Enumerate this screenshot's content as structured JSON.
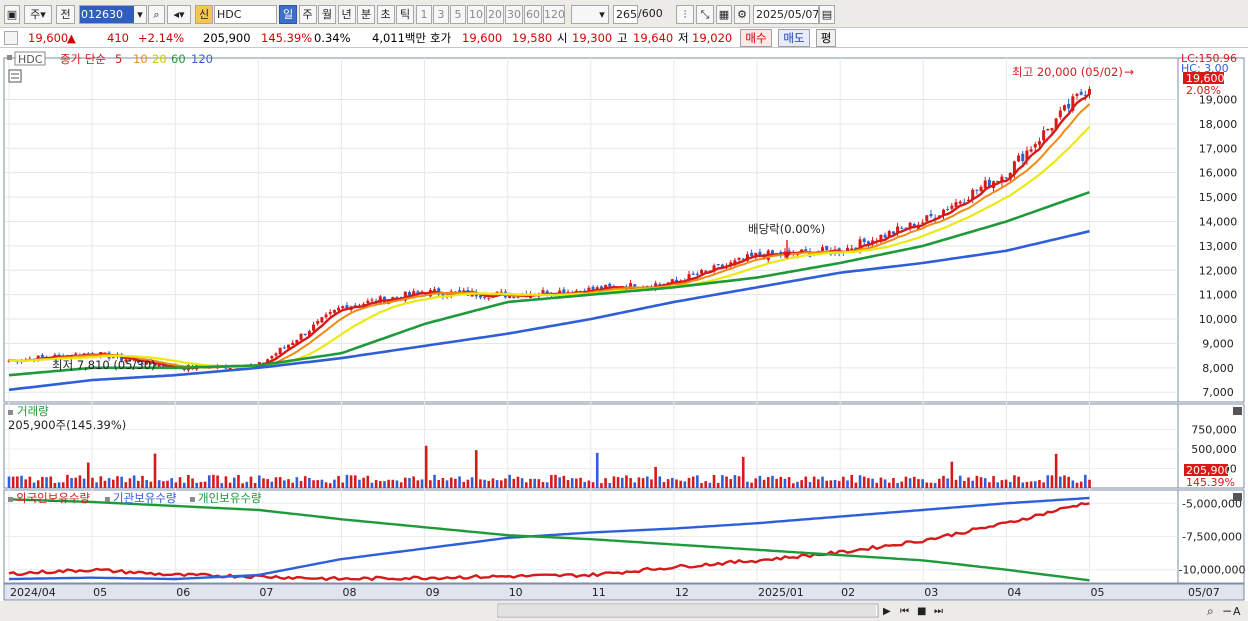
{
  "toolbar": {
    "period_type": "주",
    "prev_label": "전",
    "code": "012630",
    "new_badge": "신",
    "name": "HDC",
    "periods": [
      "일",
      "주",
      "월",
      "년",
      "분",
      "초",
      "틱"
    ],
    "active_period": "일",
    "intervals": [
      "1",
      "3",
      "5",
      "10",
      "20",
      "30",
      "60",
      "120"
    ],
    "count": "265",
    "count_max": "/600",
    "date": "2025/05/07"
  },
  "quote": {
    "price": "19,600",
    "change_arrow": "▲",
    "change": "410",
    "change_pct": "+2.14%",
    "volume": "205,900",
    "volume_ratio": "145.39%",
    "turnover_pct": "0.34%",
    "amount": "4,011백만",
    "hoga_label": "호가",
    "ask": "19,600",
    "bid": "19,580",
    "open_label": "시",
    "open": "19,300",
    "high_label": "고",
    "high": "19,640",
    "low_label": "저",
    "low": "19,020",
    "buy_label": "매수",
    "sell_label": "매도",
    "avg_label": "평"
  },
  "legend": {
    "name": "HDC",
    "price_label": "종가 단순",
    "ma_periods": [
      "5",
      "10",
      "20",
      "60",
      "120"
    ],
    "ma_colors": [
      "#d61a1a",
      "#f08a14",
      "#eaea10",
      "#1f9a3a",
      "#2f5fd8"
    ]
  },
  "annotations": {
    "high": "최고 20,000 (05/02)",
    "low": "최저 7,810 (05/30)",
    "dividend": "배당락(0.00%)"
  },
  "price_axis": {
    "ticks": [
      "19,000",
      "18,000",
      "17,000",
      "16,000",
      "15,000",
      "14,000",
      "13,000",
      "12,000",
      "11,000",
      "10,000",
      "9,000",
      "8,000",
      "7,000"
    ],
    "lc_label": "LC:150.96",
    "hc_label": "HC: 3.00",
    "current_label": "19,600",
    "current_pct": "2.08%"
  },
  "volume_panel": {
    "title": "거래량",
    "value_text": "205,900주(145.39%)",
    "ticks": [
      "750,000",
      "500,000",
      "250,000"
    ],
    "current_label": "205,900",
    "current_pct": "145.39%"
  },
  "holdings_panel": {
    "series_labels": [
      "외국인보유수량",
      "기관보유수량",
      "개인보유수량"
    ],
    "series_colors": [
      "#d61a1a",
      "#2f5fd8",
      "#1f9a3a"
    ],
    "ticks": [
      "-5,000,000",
      "-7,500,000",
      "-10,000,000"
    ]
  },
  "x_axis": {
    "labels": [
      "2024/04",
      "05",
      "06",
      "07",
      "08",
      "09",
      "10",
      "11",
      "12",
      "2025/01",
      "02",
      "03",
      "04",
      "05"
    ],
    "right_label": "05/07"
  },
  "chart_data": {
    "type": "line",
    "title": "",
    "xlabel": "",
    "ylabel": "",
    "x": [
      "2024/04",
      "2024/05",
      "2024/06",
      "2024/07",
      "2024/08",
      "2024/09",
      "2024/10",
      "2024/11",
      "2024/12",
      "2025/01",
      "2025/02",
      "2025/03",
      "2025/04",
      "2025/05"
    ],
    "ylim": [
      7000,
      20000
    ],
    "series": [
      {
        "name": "5",
        "values": [
          8300,
          8600,
          8000,
          8100,
          10500,
          11100,
          11000,
          11200,
          11500,
          12600,
          12800,
          14000,
          16000,
          19600
        ]
      },
      {
        "name": "60",
        "values": [
          7700,
          8000,
          8000,
          8100,
          8600,
          9800,
          10700,
          11000,
          11300,
          11700,
          12300,
          13000,
          14000,
          15200
        ]
      },
      {
        "name": "120",
        "values": [
          7100,
          7500,
          7700,
          8000,
          8400,
          8900,
          9400,
          10000,
          10700,
          11300,
          11900,
          12300,
          12800,
          13600
        ]
      }
    ],
    "volume_ylim": [
      0,
      1000000
    ],
    "holdings_ylim": [
      -11000000,
      -4000000
    ]
  }
}
